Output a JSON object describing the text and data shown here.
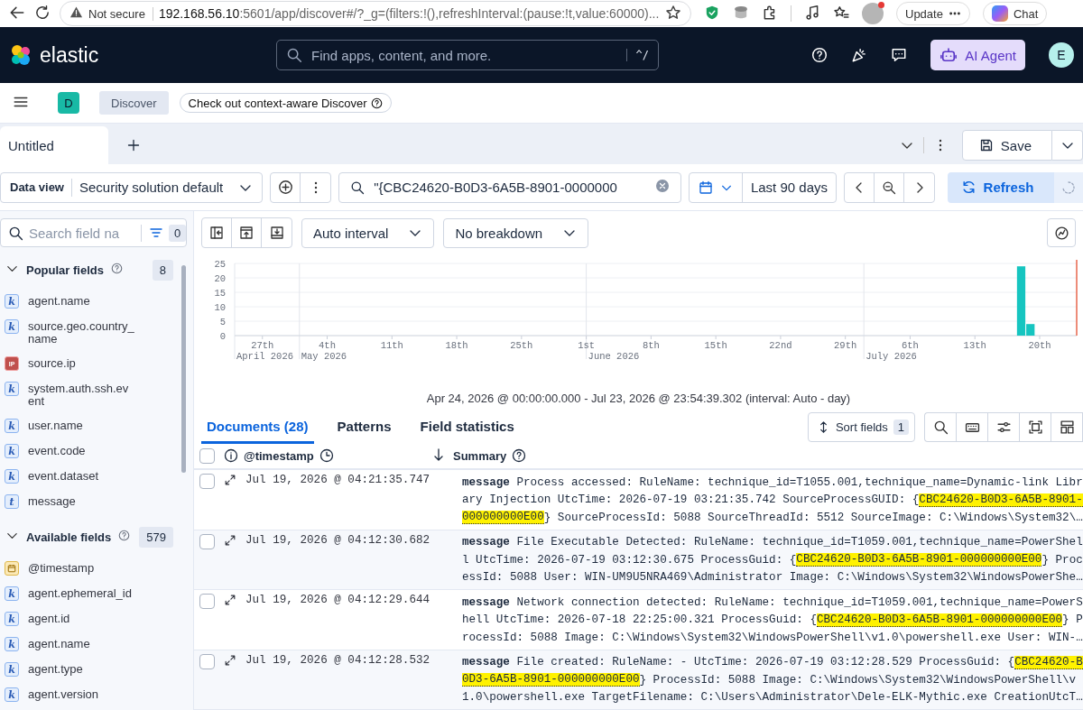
{
  "browser": {
    "security_label": "Not secure",
    "url_host": "192.168.56.10",
    "url_rest": ":5601/app/discover#/?_g=(filters:!(),refreshInterval:(pause:!t,value:60000)...",
    "update_button": "Update",
    "chat_button": "Chat"
  },
  "header": {
    "logo_text": "elastic",
    "search_placeholder": "Find apps, content, and more.",
    "search_shortcut": "^/",
    "ai_button": "AI Agent",
    "avatar_initial": "E"
  },
  "breadcrumbs": {
    "space_initial": "D",
    "items": [
      "Discover"
    ],
    "promo": "Check out context-aware Discover"
  },
  "tabs": [
    {
      "label": "Untitled",
      "selected": true
    }
  ],
  "save_button": "Save",
  "query_bar": {
    "data_view_label": "Data view",
    "data_view": "Security solution default",
    "query": "\"{CBC24620-B0D3-6A5B-8901-0000000",
    "date_range": "Last 90 days",
    "refresh_button": "Refresh"
  },
  "sidebar": {
    "search_placeholder": "Search field na",
    "filter_count": "0",
    "groups": [
      {
        "title": "Popular fields",
        "count": "8",
        "expanded": true,
        "fields": [
          {
            "name": "agent.name",
            "kind": "keyword",
            "badge": "k"
          },
          {
            "name": "source.geo.country_name",
            "kind": "keyword",
            "badge": "k"
          },
          {
            "name": "source.ip",
            "kind": "ip",
            "badge": "IP"
          },
          {
            "name": "system.auth.ssh.event",
            "kind": "keyword",
            "badge": "k"
          },
          {
            "name": "user.name",
            "kind": "keyword",
            "badge": "k"
          },
          {
            "name": "event.code",
            "kind": "keyword",
            "badge": "k"
          },
          {
            "name": "event.dataset",
            "kind": "keyword",
            "badge": "k"
          },
          {
            "name": "message",
            "kind": "text",
            "badge": "t"
          }
        ]
      },
      {
        "title": "Available fields",
        "count": "579",
        "expanded": true,
        "fields": [
          {
            "name": "@timestamp",
            "kind": "date"
          },
          {
            "name": "agent.ephemeral_id",
            "kind": "keyword",
            "badge": "k"
          },
          {
            "name": "agent.id",
            "kind": "keyword",
            "badge": "k"
          },
          {
            "name": "agent.name",
            "kind": "keyword",
            "badge": "k"
          },
          {
            "name": "agent.type",
            "kind": "keyword",
            "badge": "k"
          },
          {
            "name": "agent.version",
            "kind": "keyword",
            "badge": "k"
          }
        ]
      }
    ]
  },
  "histogram": {
    "interval": "Auto interval",
    "breakdown": "No breakdown",
    "range_caption": "Apr 24, 2026 @ 00:00:00.000 - Jul 23, 2026 @ 23:54:39.302 (interval: Auto - day)",
    "chart_data": {
      "type": "bar",
      "x": [
        "2026-07-18",
        "2026-07-19"
      ],
      "series": [
        {
          "color": "#16c5c0",
          "values": [
            24,
            4
          ]
        }
      ],
      "grid": true,
      "ref_lines": [
        {
          "axis": "x",
          "value": "2026-07-24",
          "color": "#e7664c"
        }
      ],
      "xlim": [
        "2026-04-24",
        "2026-07-24"
      ],
      "ylim": [
        0,
        25
      ],
      "yticks": [
        0,
        5,
        10,
        15,
        20,
        25
      ],
      "xticks": [
        {
          "value": "2026-04-27",
          "label": "27th"
        },
        {
          "value": "2026-05-04",
          "label": "4th"
        },
        {
          "value": "2026-05-11",
          "label": "11th"
        },
        {
          "value": "2026-05-18",
          "label": "18th"
        },
        {
          "value": "2026-05-25",
          "label": "25th"
        },
        {
          "value": "2026-06-01",
          "label": "1st"
        },
        {
          "value": "2026-06-08",
          "label": "8th"
        },
        {
          "value": "2026-06-15",
          "label": "15th"
        },
        {
          "value": "2026-06-22",
          "label": "22nd"
        },
        {
          "value": "2026-06-29",
          "label": "29th"
        },
        {
          "value": "2026-07-06",
          "label": "6th"
        },
        {
          "value": "2026-07-13",
          "label": "13th"
        },
        {
          "value": "2026-07-20",
          "label": "20th"
        }
      ],
      "annotations": [
        "April 2026",
        "May 2026",
        "June 2026",
        "July 2026"
      ]
    }
  },
  "results": {
    "tabs": [
      {
        "label": "Documents (28)",
        "selected": true
      },
      {
        "label": "Patterns",
        "selected": false
      },
      {
        "label": "Field statistics",
        "selected": false
      }
    ],
    "sort_button": "Sort fields",
    "all_checked": false,
    "sort_count": "1",
    "columns": [
      "@timestamp",
      "Summary"
    ],
    "rows": [
      {
        "checked": false,
        "timestamp": "Jul 19, 2026 @ 04:21:35.747",
        "field": "message",
        "lines": [
          [
            {
              "text": "Process accessed: RuleName: technique_id=T1055.001,technique_name=Dynamic-link Libr",
              "highlighted": false
            }
          ],
          [
            {
              "text": "ary Injection UtcTime: 2026-07-19 03:21:35.742 SourceProcessGUID: {",
              "highlighted": false
            },
            {
              "text": "CBC24620-B0D3-6A5B-8901-",
              "highlighted": true
            }
          ],
          [
            {
              "text": "000000000E00",
              "highlighted": true
            },
            {
              "text": "} SourceProcessId: 5088 SourceThreadId: 5512 SourceImage: C:\\Windows\\System32\\…",
              "highlighted": false
            }
          ]
        ]
      },
      {
        "checked": false,
        "timestamp": "Jul 19, 2026 @ 04:12:30.682",
        "field": "message",
        "lines": [
          [
            {
              "text": "File Executable Detected: RuleName: technique_id=T1059.001,technique_name=PowerShel",
              "highlighted": false
            }
          ],
          [
            {
              "text": "l UtcTime: 2026-07-19 03:12:30.675 ProcessGuid: {",
              "highlighted": false
            },
            {
              "text": "CBC24620-B0D3-6A5B-8901-000000000E00",
              "highlighted": true
            },
            {
              "text": "} Proc",
              "highlighted": false
            }
          ],
          [
            {
              "text": "essId: 5088 User: WIN-UM9U5NRA469\\Administrator Image: C:\\Windows\\System32\\WindowsPowerShe…",
              "highlighted": false
            }
          ]
        ]
      },
      {
        "checked": false,
        "timestamp": "Jul 19, 2026 @ 04:12:29.644",
        "field": "message",
        "lines": [
          [
            {
              "text": "Network connection detected: RuleName: technique_id=T1059.001,technique_name=PowerS",
              "highlighted": false
            }
          ],
          [
            {
              "text": "hell UtcTime: 2026-07-18 22:25:00.321 ProcessGuid: {",
              "highlighted": false
            },
            {
              "text": "CBC24620-B0D3-6A5B-8901-000000000E00",
              "highlighted": true
            },
            {
              "text": "} P",
              "highlighted": false
            }
          ],
          [
            {
              "text": "rocessId: 5088 Image: C:\\Windows\\System32\\WindowsPowerShell\\v1.0\\powershell.exe User: WIN-…",
              "highlighted": false
            }
          ]
        ]
      },
      {
        "checked": false,
        "timestamp": "Jul 19, 2026 @ 04:12:28.532",
        "field": "message",
        "lines": [
          [
            {
              "text": "File created: RuleName: - UtcTime: 2026-07-19 03:12:28.529 ProcessGuid: {",
              "highlighted": false
            },
            {
              "text": "CBC24620-B",
              "highlighted": true
            }
          ],
          [
            {
              "text": "0D3-6A5B-8901-000000000E00",
              "highlighted": true
            },
            {
              "text": "} ProcessId: 5088 Image: C:\\Windows\\System32\\WindowsPowerShell\\v",
              "highlighted": false
            }
          ],
          [
            {
              "text": "1.0\\powershell.exe TargetFilename: C:\\Users\\Administrator\\Dele-ELK-Mythic.exe CreationUtcT…",
              "highlighted": false
            }
          ]
        ]
      }
    ]
  }
}
